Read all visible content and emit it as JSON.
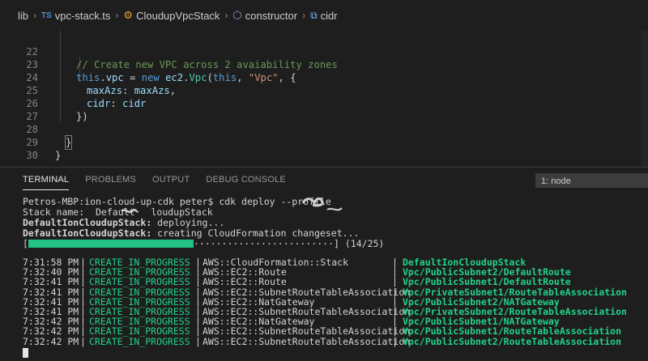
{
  "breadcrumb": {
    "items": [
      "lib",
      "vpc-stack.ts",
      "CloudupVpcStack",
      "constructor",
      "cidr"
    ],
    "ts_badge": "TS"
  },
  "editor": {
    "lines": [
      {
        "n": "22",
        "text": "// Create new VPC across 2 avaiability zones"
      },
      {
        "n": "23",
        "text": "this.vpc = new ec2.Vpc(this, \"Vpc\", {"
      },
      {
        "n": "24",
        "text": "maxAzs: maxAzs,"
      },
      {
        "n": "25",
        "text": "cidr: cidr"
      },
      {
        "n": "26",
        "text": "})"
      },
      {
        "n": "27",
        "text": ""
      },
      {
        "n": "28",
        "text": "}"
      },
      {
        "n": "29",
        "text": "}"
      },
      {
        "n": "30",
        "text": ""
      }
    ]
  },
  "panel": {
    "tabs": [
      "TERMINAL",
      "PROBLEMS",
      "OUTPUT",
      "DEBUG CONSOLE"
    ],
    "active_tab": "TERMINAL",
    "terminal_select": "1: node"
  },
  "terminal": {
    "prompt": "Petros-MBP:ion-cloud-up-cdk peter$ cdk deploy --profile",
    "stack_name_label": "Stack name:  Default",
    "stack_name_suffix": "loudupStack",
    "deploying_label": "DefaultIonCloudupStack:",
    "deploying_text": " deploying...",
    "changeset_label": "DefaultIonCloudupStack:",
    "changeset_text": " creating CloudFormation changeset...",
    "progress_open": "[",
    "progress_dots": "·························",
    "progress_close": "] (14/25)",
    "progress_value": 0.56,
    "events": [
      {
        "time": "7:31:58 PM",
        "status": "CREATE_IN_PROGRESS",
        "type": "AWS::CloudFormation::Stack",
        "id": "DefaultIonCloudupStack"
      },
      {
        "time": "7:32:40 PM",
        "status": "CREATE_IN_PROGRESS",
        "type": "AWS::EC2::Route",
        "id": "Vpc/PublicSubnet2/DefaultRoute"
      },
      {
        "time": "7:32:41 PM",
        "status": "CREATE_IN_PROGRESS",
        "type": "AWS::EC2::Route",
        "id": "Vpc/PublicSubnet1/DefaultRoute"
      },
      {
        "time": "7:32:41 PM",
        "status": "CREATE_IN_PROGRESS",
        "type": "AWS::EC2::SubnetRouteTableAssociation",
        "id": "Vpc/PrivateSubnet1/RouteTableAssociation"
      },
      {
        "time": "7:32:41 PM",
        "status": "CREATE_IN_PROGRESS",
        "type": "AWS::EC2::NatGateway",
        "id": "Vpc/PublicSubnet2/NATGateway"
      },
      {
        "time": "7:32:41 PM",
        "status": "CREATE_IN_PROGRESS",
        "type": "AWS::EC2::SubnetRouteTableAssociation",
        "id": "Vpc/PrivateSubnet2/RouteTableAssociation"
      },
      {
        "time": "7:32:42 PM",
        "status": "CREATE_IN_PROGRESS",
        "type": "AWS::EC2::NatGateway",
        "id": "Vpc/PublicSubnet1/NATGateway"
      },
      {
        "time": "7:32:42 PM",
        "status": "CREATE_IN_PROGRESS",
        "type": "AWS::EC2::SubnetRouteTableAssociation",
        "id": "Vpc/PublicSubnet1/RouteTableAssociation"
      },
      {
        "time": "7:32:42 PM",
        "status": "CREATE_IN_PROGRESS",
        "type": "AWS::EC2::SubnetRouteTableAssociation",
        "id": "Vpc/PublicSubnet2/RouteTableAssociation"
      }
    ],
    "separator": "|"
  },
  "colors": {
    "background": "#1e1e1e",
    "green": "#23d18b",
    "progress_fill": "#23c483",
    "comment": "#6a9955",
    "keyword": "#569cd6"
  },
  "icons": [
    "typescript-icon",
    "class-icon",
    "method-icon",
    "variable-icon",
    "chevron-right-icon"
  ]
}
